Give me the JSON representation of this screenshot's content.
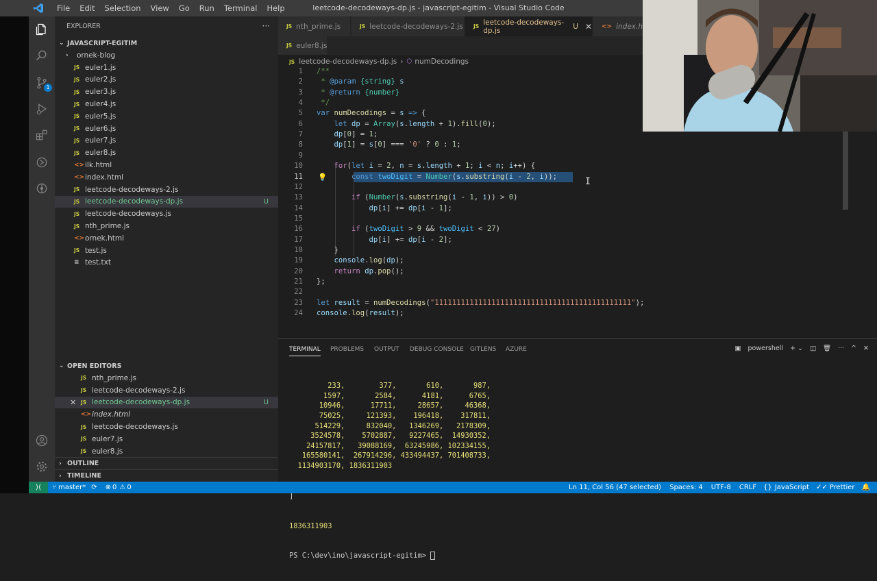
{
  "window": {
    "title": "leetcode-decodeways-dp.js - javascript-egitim - Visual Studio Code"
  },
  "menu": [
    "File",
    "Edit",
    "Selection",
    "View",
    "Go",
    "Run",
    "Terminal",
    "Help"
  ],
  "explorer": {
    "title": "EXPLORER",
    "project": "JAVASCRIPT-EGITIM",
    "folder": "ornek-blog",
    "files": [
      {
        "name": "euler1.js",
        "type": "js"
      },
      {
        "name": "euler2.js",
        "type": "js"
      },
      {
        "name": "euler3.js",
        "type": "js"
      },
      {
        "name": "euler4.js",
        "type": "js"
      },
      {
        "name": "euler5.js",
        "type": "js"
      },
      {
        "name": "euler6.js",
        "type": "js"
      },
      {
        "name": "euler7.js",
        "type": "js"
      },
      {
        "name": "euler8.js",
        "type": "js"
      },
      {
        "name": "ilk.html",
        "type": "html"
      },
      {
        "name": "index.html",
        "type": "html"
      },
      {
        "name": "leetcode-decodeways-2.js",
        "type": "js"
      },
      {
        "name": "leetcode-decodeways-dp.js",
        "type": "js",
        "badge": "U"
      },
      {
        "name": "leetcode-decodeways.js",
        "type": "js"
      },
      {
        "name": "nth_prime.js",
        "type": "js"
      },
      {
        "name": "ornek.html",
        "type": "html"
      },
      {
        "name": "test.js",
        "type": "js"
      },
      {
        "name": "test.txt",
        "type": "txt"
      }
    ]
  },
  "open_editors": {
    "title": "OPEN EDITORS",
    "files": [
      {
        "name": "nth_prime.js",
        "type": "js"
      },
      {
        "name": "leetcode-decodeways-2.js",
        "type": "js"
      },
      {
        "name": "leetcode-decodeways-dp.js",
        "type": "js",
        "badge": "U"
      },
      {
        "name": "index.html",
        "type": "html"
      },
      {
        "name": "leetcode-decodeways.js",
        "type": "js"
      },
      {
        "name": "euler7.js",
        "type": "js"
      },
      {
        "name": "euler8.js",
        "type": "js"
      }
    ]
  },
  "outline": "OUTLINE",
  "timeline": "TIMELINE",
  "tabs": [
    {
      "name": "nth_prime.js"
    },
    {
      "name": "leetcode-decodeways-2.js"
    },
    {
      "name": "leetcode-decodeways-dp.js",
      "badge": "U"
    },
    {
      "name": "index.html"
    },
    {
      "name": "euler8.js"
    }
  ],
  "breadcrumb": {
    "file": "leetcode-decodeways-dp.js",
    "symbol": "numDecodings"
  },
  "terminal": {
    "tabs": [
      "TERMINAL",
      "PROBLEMS",
      "OUTPUT",
      "DEBUG CONSOLE",
      "GITLENS",
      "AZURE"
    ],
    "shell": "powershell",
    "lines": [
      "         233,        377,       610,       987,",
      "        1597,       2584,      4181,      6765,",
      "       10946,      17711,     28657,     46368,",
      "       75025,     121393,    196418,    317811,",
      "      514229,     832040,   1346269,   2178309,",
      "     3524578,    5702887,   9227465,  14930352,",
      "    24157817,   39088169,  63245986, 102334155,",
      "   165580141,  267914296, 433494437, 701408733,",
      "  1134903170, 1836311903"
    ],
    "close_bracket": "]",
    "result": "1836311903",
    "prompt": "PS C:\\dev\\ino\\javascript-egitim> "
  },
  "status": {
    "branch": "master*",
    "errors": "0",
    "warnings": "0",
    "position": "Ln 11, Col 56 (47 selected)",
    "spaces": "Spaces: 4",
    "encoding": "UTF-8",
    "eol": "CRLF",
    "language": "JavaScript",
    "formatter": "Prettier"
  }
}
